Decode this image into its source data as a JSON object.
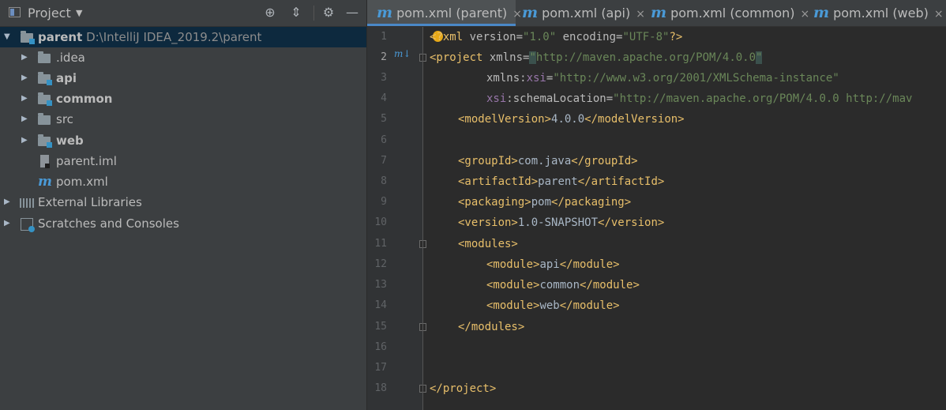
{
  "project_panel": {
    "title": "Project",
    "dropdown_icon": "▼",
    "tools": {
      "locate": "⊕",
      "collapse": "⇕",
      "settings": "⚙",
      "hide": "—"
    },
    "tree": [
      {
        "label": "parent",
        "path": "D:\\IntelliJ IDEA_2019.2\\parent",
        "bold": true,
        "expanded": true
      },
      {
        "label": ".idea",
        "bold": false
      },
      {
        "label": "api",
        "bold": true
      },
      {
        "label": "common",
        "bold": true
      },
      {
        "label": "src",
        "bold": false
      },
      {
        "label": "web",
        "bold": true
      },
      {
        "label": "parent.iml",
        "bold": false
      },
      {
        "label": "pom.xml",
        "bold": false
      },
      {
        "label": "External Libraries",
        "bold": false
      },
      {
        "label": "Scratches and Consoles",
        "bold": false
      }
    ]
  },
  "editor": {
    "tabs": [
      {
        "label": "pom.xml (parent)",
        "active": true
      },
      {
        "label": "pom.xml (api)"
      },
      {
        "label": "pom.xml (common)"
      },
      {
        "label": "pom.xml (web)"
      }
    ],
    "tab_icon": "m",
    "close_glyph": "×",
    "line_numbers": [
      "1",
      "2",
      "3",
      "4",
      "5",
      "6",
      "7",
      "8",
      "9",
      "10",
      "11",
      "12",
      "13",
      "14",
      "15",
      "16",
      "17",
      "18"
    ],
    "gutter_maven_marker": "m↓",
    "code": {
      "l1": {
        "open": "<",
        "decl": "?xml",
        "a1": " version=",
        "v1": "\"1.0\"",
        "a2": " encoding=",
        "v2": "\"UTF-8\"",
        "close": "?>"
      },
      "l2": {
        "tag": "<project",
        "attr": " xmlns=",
        "q1": "\"",
        "val": "http://maven.apache.org/POM/4.0.0",
        "q2": "\""
      },
      "l3": {
        "attr": "xmlns:",
        "ns": "xsi",
        "eq": "=",
        "val": "\"http://www.w3.org/2001/XMLSchema-instance\""
      },
      "l4": {
        "ns": "xsi",
        "attr": ":schemaLocation=",
        "val": "\"http://maven.apache.org/POM/4.0.0 http://mav"
      },
      "l5": {
        "open": "<modelVersion>",
        "text": "4.0.0",
        "close": "</modelVersion>"
      },
      "l7": {
        "open": "<groupId>",
        "text": "com.java",
        "close": "</groupId>"
      },
      "l8": {
        "open": "<artifactId>",
        "text": "parent",
        "close": "</artifactId>"
      },
      "l9": {
        "open": "<packaging>",
        "text": "pom",
        "close": "</packaging>"
      },
      "l10": {
        "open": "<version>",
        "text": "1.0-SNAPSHOT",
        "close": "</version>"
      },
      "l11": {
        "open": "<modules>"
      },
      "l12": {
        "open": "<module>",
        "text": "api",
        "close": "</module>"
      },
      "l13": {
        "open": "<module>",
        "text": "common",
        "close": "</module>"
      },
      "l14": {
        "open": "<module>",
        "text": "web",
        "close": "</module>"
      },
      "l15": {
        "close": "</modules>"
      },
      "l18": {
        "close": "</project>"
      }
    }
  }
}
